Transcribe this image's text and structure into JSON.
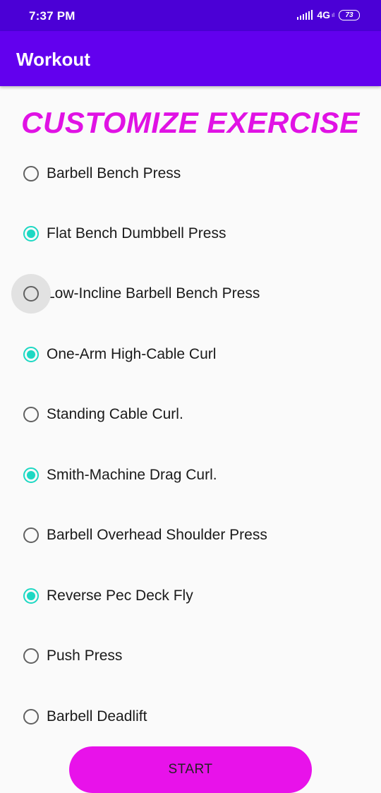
{
  "status_bar": {
    "time": "7:37 PM",
    "network": "4G",
    "network_sub": "ıl",
    "battery": "73"
  },
  "app_bar": {
    "title": "Workout"
  },
  "heading": "CUSTOMIZE EXERCISE",
  "options": [
    {
      "label": "Barbell Bench Press",
      "checked": false
    },
    {
      "label": "Flat Bench Dumbbell Press",
      "checked": true
    },
    {
      "label": "Low-Incline Barbell Bench Press",
      "checked": false,
      "pressed": true
    },
    {
      "label": "One-Arm High-Cable Curl",
      "checked": true
    },
    {
      "label": "Standing Cable Curl.",
      "checked": false
    },
    {
      "label": "Smith-Machine Drag Curl.",
      "checked": true
    },
    {
      "label": "Barbell Overhead Shoulder Press",
      "checked": false
    },
    {
      "label": "Reverse Pec Deck Fly",
      "checked": true
    },
    {
      "label": "Push Press",
      "checked": false
    },
    {
      "label": "Barbell Deadlift",
      "checked": false
    }
  ],
  "start_button": {
    "label": "START"
  },
  "colors": {
    "status_bar": "#4b00d6",
    "app_bar": "#6200ee",
    "heading": "#e012e4",
    "radio_checked": "#1dd8c3",
    "start_button": "#e812ea"
  },
  "icons": {
    "signal": "signal-bars-icon",
    "battery": "battery-icon"
  }
}
